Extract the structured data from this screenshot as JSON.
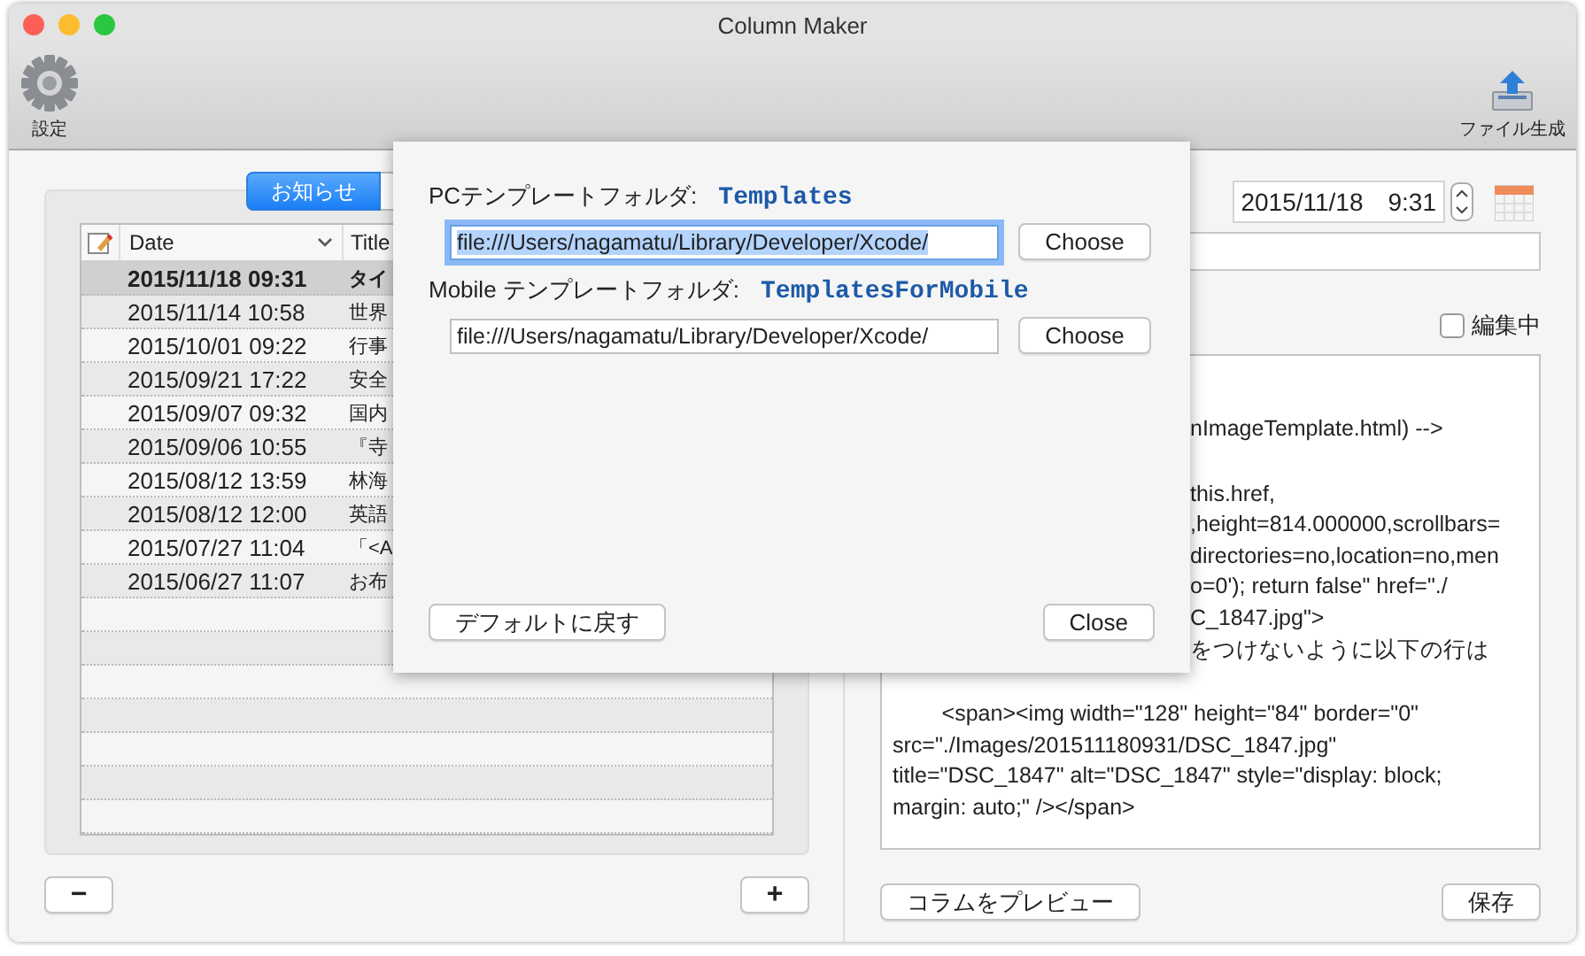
{
  "window": {
    "title": "Column Maker"
  },
  "toolbar": [
    {
      "label": "設定",
      "kind": "gear"
    },
    {
      "label": "ファイル生成",
      "kind": "export"
    }
  ],
  "tabs": [
    {
      "label": "お知らせ",
      "selected": true
    }
  ],
  "table": {
    "columns": [
      "Date",
      "Title"
    ],
    "rows": [
      {
        "date": "2015/11/18 09:31",
        "title": "タイ",
        "selected": true
      },
      {
        "date": "2015/11/14 10:58",
        "title": "世界",
        "selected": false
      },
      {
        "date": "2015/10/01 09:22",
        "title": "行事",
        "selected": false
      },
      {
        "date": "2015/09/21 17:22",
        "title": "安全",
        "selected": false
      },
      {
        "date": "2015/09/07 09:32",
        "title": "国内",
        "selected": false
      },
      {
        "date": "2015/09/06 10:55",
        "title": "『寺",
        "selected": false
      },
      {
        "date": "2015/08/12 13:59",
        "title": "林海",
        "selected": false
      },
      {
        "date": "2015/08/12 12:00",
        "title": "英語",
        "selected": false
      },
      {
        "date": "2015/07/27 11:04",
        "title": "「<A",
        "selected": false
      },
      {
        "date": "2015/06/27 11:07",
        "title": "お布",
        "selected": false
      }
    ]
  },
  "left_buttons": [
    "−",
    "+"
  ],
  "date_field": {
    "value": "2015/11/18　9:31"
  },
  "editing_checkbox": {
    "label": "編集中",
    "checked": false
  },
  "editor": {
    "lines": [
      {
        "text": "nImageTemplate.html) -->",
        "kind": "cut",
        "gap": false
      },
      {
        "text": "this.href,",
        "kind": "cut",
        "gap": true
      },
      {
        "text": ",height=814.000000,scrollbars=",
        "kind": "cut",
        "gap": false
      },
      {
        "text": "directories=no,location=no,men",
        "kind": "cut",
        "gap": false
      },
      {
        "text": "o=0'); return false\" href=\"./",
        "kind": "cut",
        "gap": false
      },
      {
        "text": "C_1847.jpg\">",
        "kind": "cut",
        "gap": false
      },
      {
        "text": "をつけないように以下の行は",
        "kind": "cut",
        "gap": false
      },
      {
        "text": "        <span><img width=\"128\" height=\"84\" border=\"0\"",
        "kind": "full",
        "gap": true
      },
      {
        "text": "src=\"./Images/201511180931/DSC_1847.jpg\"",
        "kind": "full",
        "gap": false
      },
      {
        "text": "title=\"DSC_1847\" alt=\"DSC_1847\" style=\"display: block;",
        "kind": "full",
        "gap": false
      },
      {
        "text": "margin: auto;\" /></span>",
        "kind": "full",
        "gap": false
      }
    ]
  },
  "right_buttons": [
    "コラムをプレビュー",
    "保存"
  ],
  "sheet": {
    "folders": [
      {
        "label": "PCテンプレートフォルダ:",
        "name": "Templates",
        "path": "file:///Users/nagamatu/Library/Developer/Xcode/",
        "focused": true,
        "button": "Choose"
      },
      {
        "label": "Mobile テンプレートフォルダ:",
        "name": "TemplatesForMobile",
        "path": "file:///Users/nagamatu/Library/Developer/Xcode/",
        "focused": false,
        "button": "Choose"
      }
    ],
    "buttons": [
      "デフォルトに戻す",
      "Close"
    ]
  }
}
